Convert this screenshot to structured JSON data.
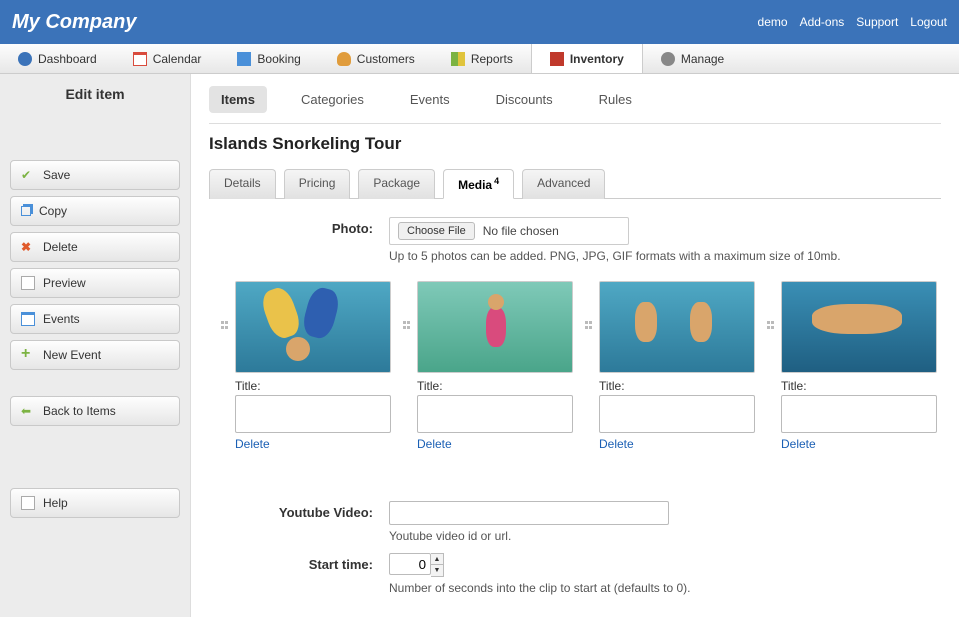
{
  "brand": "My Company",
  "toplinks": [
    "demo",
    "Add-ons",
    "Support",
    "Logout"
  ],
  "nav": [
    {
      "label": "Dashboard",
      "icon": "#3b73b9"
    },
    {
      "label": "Calendar",
      "icon": "#d94b3d"
    },
    {
      "label": "Booking",
      "icon": "#4a90d9"
    },
    {
      "label": "Customers",
      "icon": "#e09c3c"
    },
    {
      "label": "Reports",
      "icon": "#7cb342"
    },
    {
      "label": "Inventory",
      "icon": "#c0392b",
      "active": true
    },
    {
      "label": "Manage",
      "icon": "#888"
    }
  ],
  "sidebar": {
    "title": "Edit item",
    "actions": [
      {
        "label": "Save",
        "color": "#7cb342",
        "name": "save"
      },
      {
        "label": "Copy",
        "color": "#4a90d9",
        "name": "copy"
      },
      {
        "label": "Delete",
        "color": "#e05a2b",
        "name": "delete"
      },
      {
        "label": "Preview",
        "color": "#888",
        "name": "preview"
      },
      {
        "label": "Events",
        "color": "#4a90d9",
        "name": "events"
      },
      {
        "label": "New Event",
        "color": "#7cb342",
        "name": "new-event"
      }
    ],
    "back": {
      "label": "Back to Items",
      "color": "#7cb342"
    },
    "help": {
      "label": "Help",
      "color": "#888"
    }
  },
  "subtabs": [
    "Items",
    "Categories",
    "Events",
    "Discounts",
    "Rules"
  ],
  "subtab_active": 0,
  "page_title": "Islands Snorkeling Tour",
  "detail_tabs": [
    {
      "label": "Details"
    },
    {
      "label": "Pricing"
    },
    {
      "label": "Package"
    },
    {
      "label": "Media",
      "badge": "4",
      "active": true
    },
    {
      "label": "Advanced"
    }
  ],
  "form": {
    "photo_label": "Photo:",
    "choose_file": "Choose File",
    "no_file": "No file chosen",
    "photo_helper": "Up to 5 photos can be added. PNG, JPG, GIF formats with a maximum size of 10mb.",
    "title_label": "Title:",
    "delete_label": "Delete",
    "youtube_label": "Youtube Video:",
    "youtube_helper": "Youtube video id or url.",
    "start_label": "Start time:",
    "start_value": "0",
    "start_helper": "Number of seconds into the clip to start at (defaults to 0)."
  },
  "photos": [
    {
      "title": ""
    },
    {
      "title": ""
    },
    {
      "title": ""
    },
    {
      "title": ""
    }
  ]
}
